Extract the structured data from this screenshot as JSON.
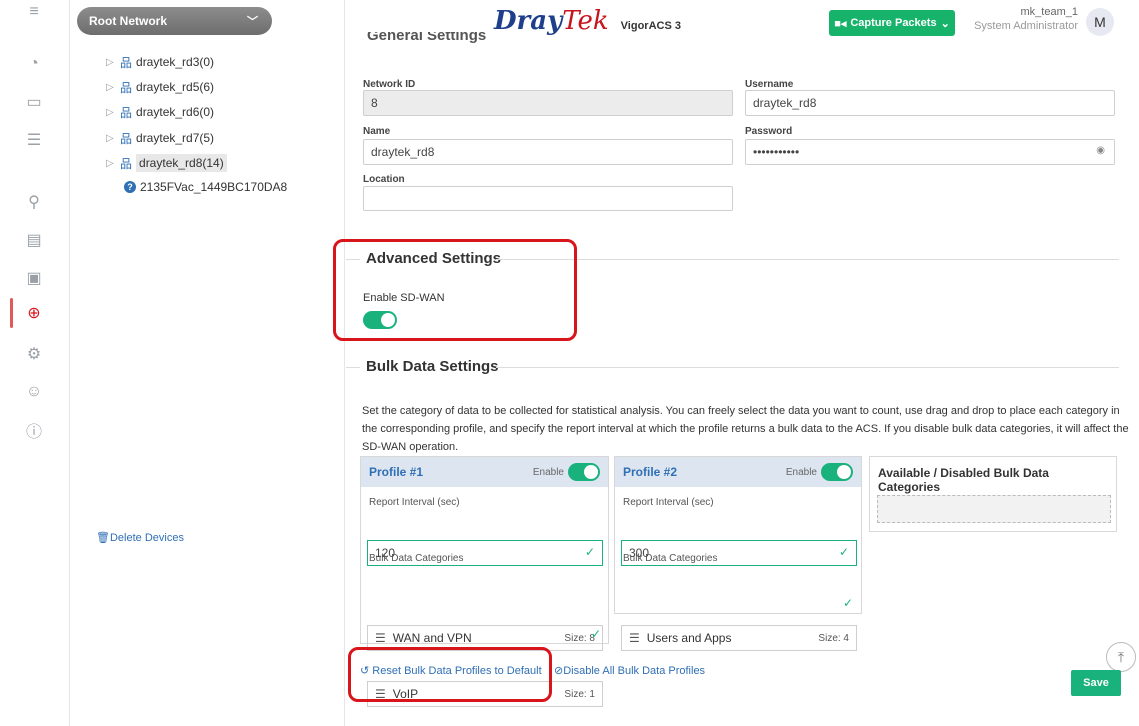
{
  "header": {
    "logo_dray": "Dray",
    "logo_tek": "Tek",
    "product": "VigorACS 3",
    "capture_label": "Capture Packets",
    "user_name": "mk_team_1",
    "user_role": "System Administrator",
    "avatar_letter": "M"
  },
  "tree": {
    "network_select": "Root Network",
    "nodes": [
      {
        "label": "draytek_rd3(0)"
      },
      {
        "label": "draytek_rd5(6)"
      },
      {
        "label": "draytek_rd6(0)"
      },
      {
        "label": "draytek_rd7(5)"
      },
      {
        "label": "draytek_rd8(14)"
      }
    ],
    "device": "2135FVac_1449BC170DA8",
    "delete_link": "Delete Devices"
  },
  "general": {
    "title": "General Settings",
    "network_id_label": "Network ID",
    "network_id_value": "8",
    "username_label": "Username",
    "username_value": "draytek_rd8",
    "name_label": "Name",
    "name_value": "draytek_rd8",
    "password_label": "Password",
    "password_value": "•••••••••••",
    "location_label": "Location",
    "location_value": ""
  },
  "advanced": {
    "title": "Advanced Settings",
    "sdwan_label": "Enable SD-WAN",
    "sdwan_enabled": true
  },
  "bulk": {
    "title": "Bulk Data Settings",
    "description": "Set the category of data to be collected for statistical analysis. You can freely select the data you want to count, use drag and drop to place each category in the corresponding profile, and specify the report interval at which the profile returns a bulk data to the ACS. If you disable bulk data categories, it will affect the SD-WAN operation.",
    "profiles": [
      {
        "title": "Profile #1",
        "enable_label": "Enable",
        "interval_label": "Report Interval (sec)",
        "interval_value": "120",
        "categories_label": "Bulk Data Categories",
        "categories": [
          {
            "name": "WAN and VPN",
            "size": "Size: 8"
          },
          {
            "name": "VoIP",
            "size": "Size: 1"
          }
        ]
      },
      {
        "title": "Profile #2",
        "enable_label": "Enable",
        "interval_label": "Report Interval (sec)",
        "interval_value": "300",
        "categories_label": "Bulk Data Categories",
        "categories": [
          {
            "name": "Users and Apps",
            "size": "Size: 4"
          }
        ]
      }
    ],
    "available_title": "Available / Disabled Bulk Data Categories",
    "reset_link": "Reset Bulk Data Profiles to Default",
    "disable_link": "Disable All Bulk Data Profiles",
    "save_label": "Save"
  },
  "colors": {
    "accent_green": "#19b27d",
    "link_blue": "#2f6fb5",
    "highlight_red": "#d9151c"
  }
}
